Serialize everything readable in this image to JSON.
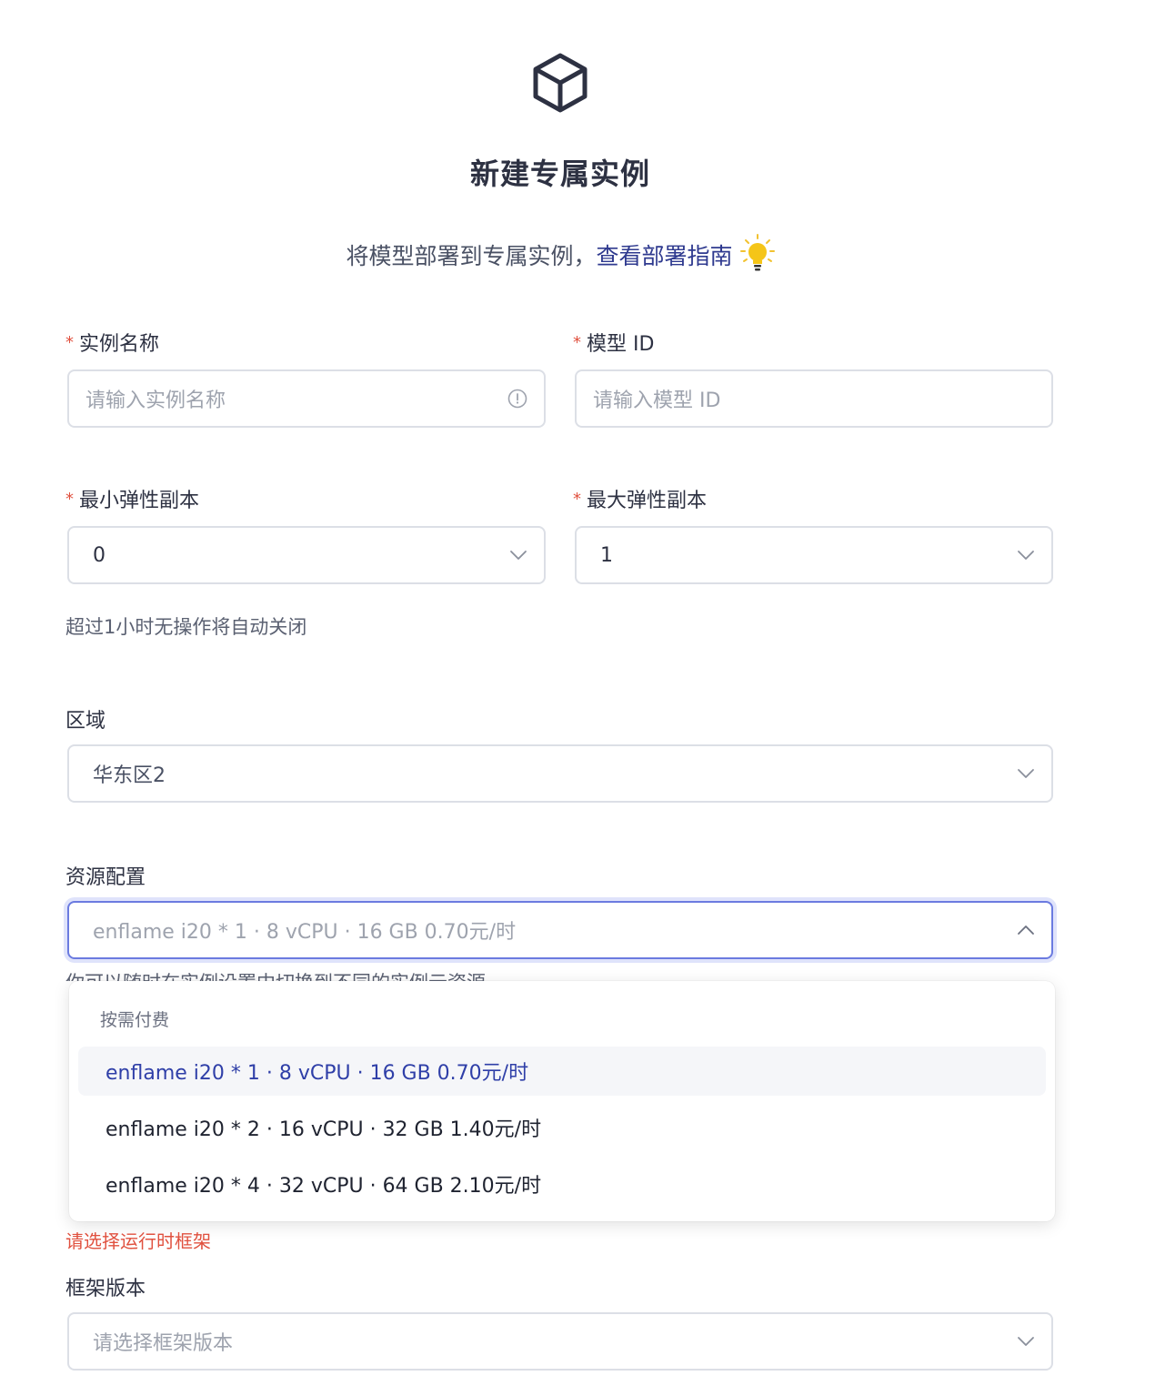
{
  "header": {
    "title": "新建专属实例",
    "subtitle_text": "将模型部署到专属实例，",
    "guide_link": "查看部署指南"
  },
  "form": {
    "instance_name": {
      "label": "实例名称",
      "placeholder": "请输入实例名称"
    },
    "model_id": {
      "label": "模型 ID",
      "placeholder": "请输入模型 ID"
    },
    "min_replicas": {
      "label": "最小弹性副本",
      "value": "0"
    },
    "max_replicas": {
      "label": "最大弹性副本",
      "value": "1"
    },
    "auto_close_hint": "超过1小时无操作将自动关闭",
    "region": {
      "label": "区域",
      "value": "华东区2"
    },
    "resource": {
      "label": "资源配置",
      "value": "enflame i20 * 1 · 8 vCPU · 16 GB 0.70元/时",
      "hint_partial": "你可以随时在实例设置中切换到不同的实例云资源"
    },
    "runtime_error": "请选择运行时框架",
    "framework_version": {
      "label": "框架版本",
      "placeholder": "请选择框架版本"
    }
  },
  "dropdown": {
    "group_label": "按需付费",
    "options": [
      "enflame i20 * 1 · 8 vCPU · 16 GB 0.70元/时",
      "enflame i20 * 2 · 16 vCPU · 32 GB 1.40元/时",
      "enflame i20 * 4 · 32 vCPU · 64 GB 2.10元/时"
    ],
    "selected_index": 0
  },
  "colors": {
    "required": "#e0513f",
    "link": "#2f3a8f",
    "selected_option": "#2f3fa8",
    "focus_border": "#6b7be0",
    "error": "#e0513f"
  },
  "icons": {
    "logo": "cube-icon",
    "guide": "lightbulb-icon",
    "name_suffix": "info-circle-icon",
    "select": "chevron-down-icon",
    "open_select": "chevron-up-icon"
  }
}
